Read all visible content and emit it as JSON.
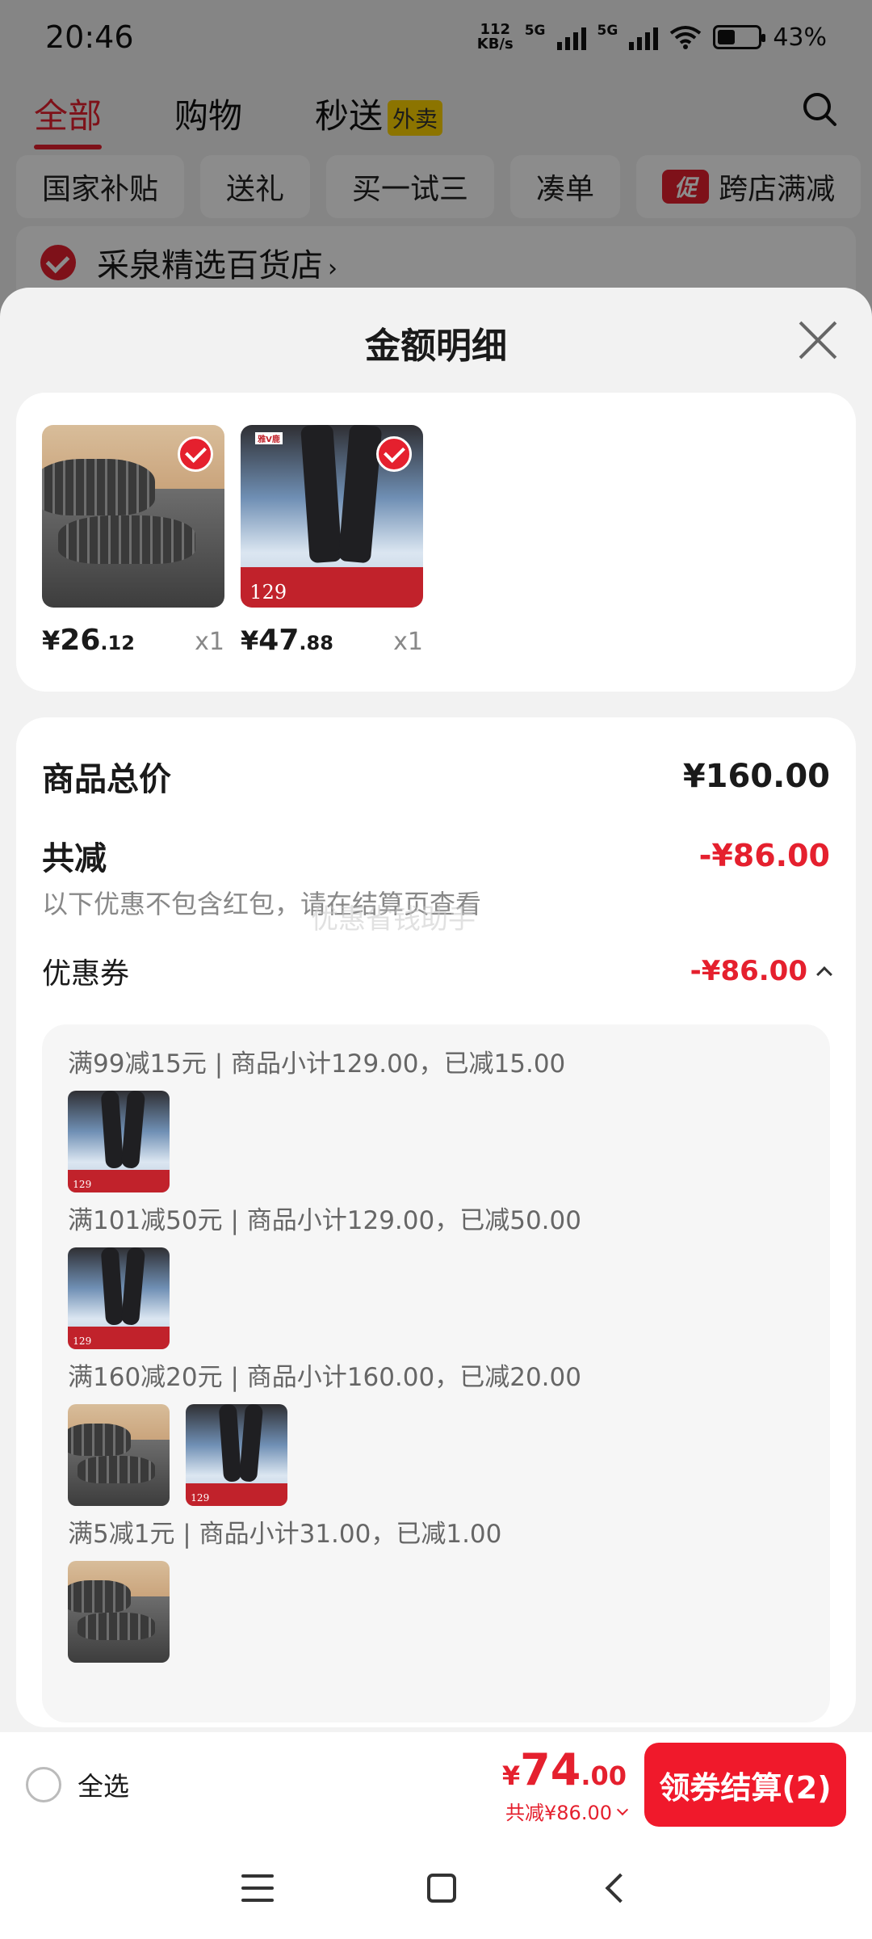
{
  "status_bar": {
    "time": "20:46",
    "net_speed_value": "112",
    "net_speed_unit": "KB/s",
    "sim1": "5G",
    "sim2": "5G",
    "battery": "43%",
    "battery_level": 0.43
  },
  "top_tabs": [
    {
      "label": "全部",
      "active": true
    },
    {
      "label": "购物",
      "active": false
    },
    {
      "label": "秒送",
      "active": false,
      "badge": "外卖"
    }
  ],
  "chips": [
    "国家补贴",
    "送礼",
    "买一试三",
    "凑单",
    "跨店满减"
  ],
  "chip_promo_badge": "促",
  "store": {
    "name": "采泉精选百货店",
    "arrow": "›"
  },
  "sheet": {
    "title": "金额明细",
    "products": [
      {
        "price_currency": "¥",
        "price_int": "26",
        "price_dec": ".12",
        "qty": "x1",
        "kind": "pillow"
      },
      {
        "price_currency": "¥",
        "price_int": "47",
        "price_dec": ".88",
        "qty": "x1",
        "kind": "pants"
      }
    ],
    "pants_thumb_text": {
      "brand": "雅V鹿",
      "tag_price": "129"
    },
    "total_label": "商品总价",
    "total_value": "¥160.00",
    "reduce_label": "共减",
    "reduce_value": "-¥86.00",
    "reduce_note": "以下优惠不包含红包，请在结算页查看",
    "watermark": "优惠省钱助手",
    "coupon_label": "优惠券",
    "coupon_value": "-¥86.00",
    "coupon_rules": [
      {
        "text": "满99减15元 | 商品小计129.00，已减15.00",
        "thumbs": [
          "pants"
        ]
      },
      {
        "text": "满101减50元 | 商品小计129.00，已减50.00",
        "thumbs": [
          "pants"
        ]
      },
      {
        "text": "满160减20元 | 商品小计160.00，已减20.00",
        "thumbs": [
          "pillow",
          "pants"
        ]
      },
      {
        "text": "满5减1元 | 商品小计31.00，已减1.00",
        "thumbs": [
          "pillow"
        ]
      }
    ]
  },
  "bottom_bar": {
    "select_all": "全选",
    "total_currency": "¥",
    "total_int": "74",
    "total_dec": ".00",
    "total_save": "共减¥86.00",
    "checkout": "领券结算(2)"
  },
  "colors": {
    "accent": "#e5202e",
    "button": "#f0192b"
  }
}
